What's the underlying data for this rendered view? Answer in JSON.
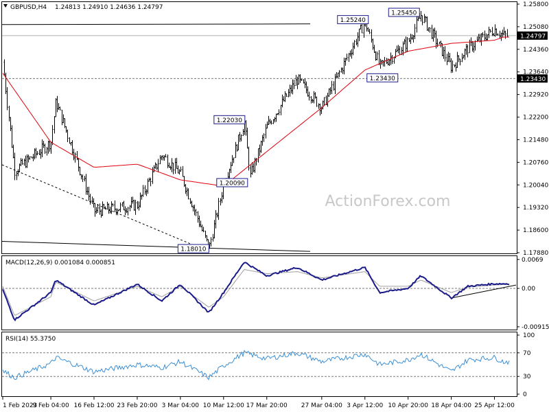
{
  "colors": {
    "background": "#ffffff",
    "candle": "#000000",
    "ma": "#e0000b",
    "macd_main": "#1a1a8a",
    "macd_signal": "#a0a0a0",
    "rsi": "#3a8fd6",
    "label_box": "#1a1a8a",
    "watermark": "#c8c8c8",
    "grid_dash": "#7a7a7a",
    "price_tag_bg": "#000000",
    "price_tag_fg": "#ffffff"
  },
  "header": {
    "symbol": "GBPUSD,H4",
    "ohlc": "1.24813 1.24910 1.24636 1.24797"
  },
  "watermark": "ActionForex.com",
  "chart_data": [
    {
      "type": "candlestick",
      "title": "GBPUSD,H4",
      "yaxis_ticks": [
        "1.25800",
        "1.25080",
        "1.24360",
        "1.23640",
        "1.22920",
        "1.22200",
        "1.21480",
        "1.20760",
        "1.20040",
        "1.19320",
        "1.18600",
        "1.17880"
      ],
      "ylim": [
        1.1788,
        1.258
      ],
      "current_price": "1.24797",
      "support_level": "1.23430",
      "annotations": [
        "1.25240",
        "1.25450",
        "1.23430",
        "1.22030",
        "1.20090",
        "1.18010"
      ],
      "x_tick_labels": [
        "1 Feb 2023",
        "9 Feb 04:00",
        "16 Feb 12:00",
        "23 Feb 20:00",
        "3 Mar 04:00",
        "10 Mar 12:00",
        "17 Mar 20:00",
        "27 Mar 04:00",
        "3 Apr 12:00",
        "10 Apr 20:00",
        "18 Apr 04:00",
        "25 Apr 12:00"
      ],
      "key_points": [
        {
          "x": "1 Feb 2023",
          "y": 1.2395
        },
        {
          "x": "3 Feb 2023",
          "y": 1.205
        },
        {
          "x": "9 Feb 04:00",
          "y": 1.214
        },
        {
          "x": "10 Feb 2023",
          "y": 1.227
        },
        {
          "x": "16 Feb 12:00",
          "y": 1.192
        },
        {
          "x": "23 Feb 20:00",
          "y": 1.194
        },
        {
          "x": "28 Feb 2023",
          "y": 1.21
        },
        {
          "x": "3 Mar 04:00",
          "y": 1.204
        },
        {
          "x": "8 Mar 2023",
          "y": 1.1801
        },
        {
          "x": "10 Mar 12:00",
          "y": 1.2009
        },
        {
          "x": "14 Mar 2023",
          "y": 1.2203
        },
        {
          "x": "15 Mar 2023",
          "y": 1.203
        },
        {
          "x": "17 Mar 20:00",
          "y": 1.219
        },
        {
          "x": "23 Mar 2023",
          "y": 1.234
        },
        {
          "x": "27 Mar 04:00",
          "y": 1.225
        },
        {
          "x": "3 Apr 12:00",
          "y": 1.2524
        },
        {
          "x": "6 Apr 2023",
          "y": 1.238
        },
        {
          "x": "10 Apr 20:00",
          "y": 1.246
        },
        {
          "x": "13 Apr 2023",
          "y": 1.2545
        },
        {
          "x": "18 Apr 04:00",
          "y": 1.238
        },
        {
          "x": "21 Apr 2023",
          "y": 1.244
        },
        {
          "x": "25 Apr 12:00",
          "y": 1.25
        },
        {
          "x": "27 Apr 2023",
          "y": 1.248
        }
      ],
      "moving_average": [
        {
          "x": "1 Feb 2023",
          "y": 1.236
        },
        {
          "x": "9 Feb 04:00",
          "y": 1.214
        },
        {
          "x": "16 Feb 12:00",
          "y": 1.206
        },
        {
          "x": "23 Feb 20:00",
          "y": 1.207
        },
        {
          "x": "3 Mar 04:00",
          "y": 1.202
        },
        {
          "x": "10 Mar 12:00",
          "y": 1.2
        },
        {
          "x": "17 Mar 20:00",
          "y": 1.211
        },
        {
          "x": "27 Mar 04:00",
          "y": 1.225
        },
        {
          "x": "3 Apr 12:00",
          "y": 1.237
        },
        {
          "x": "10 Apr 20:00",
          "y": 1.243
        },
        {
          "x": "18 Apr 04:00",
          "y": 1.2455
        },
        {
          "x": "25 Apr 12:00",
          "y": 1.2465
        },
        {
          "x": "27 Apr 2023",
          "y": 1.2475
        }
      ]
    },
    {
      "type": "line",
      "title": "MACD(12,26,9) 0.001084 0.000851",
      "yaxis_ticks": [
        "0.0069",
        "0.00",
        "-0.009158"
      ],
      "ylim": [
        -0.0095,
        0.0072
      ],
      "series": [
        {
          "name": "MACD",
          "points": [
            {
              "x": "1 Feb 2023",
              "y": -0.0003
            },
            {
              "x": "3 Feb 2023",
              "y": -0.0075
            },
            {
              "x": "9 Feb 04:00",
              "y": -0.001
            },
            {
              "x": "10 Feb 2023",
              "y": 0.002
            },
            {
              "x": "16 Feb 12:00",
              "y": -0.004
            },
            {
              "x": "23 Feb 20:00",
              "y": 0.001
            },
            {
              "x": "28 Feb 2023",
              "y": -0.003
            },
            {
              "x": "3 Mar 04:00",
              "y": 0.001
            },
            {
              "x": "8 Mar 2023",
              "y": -0.0058
            },
            {
              "x": "10 Mar 12:00",
              "y": -0.001
            },
            {
              "x": "14 Mar 2023",
              "y": 0.0063
            },
            {
              "x": "17 Mar 20:00",
              "y": 0.003
            },
            {
              "x": "23 Mar 2023",
              "y": 0.005
            },
            {
              "x": "27 Mar 04:00",
              "y": 0.002
            },
            {
              "x": "3 Apr 12:00",
              "y": 0.005
            },
            {
              "x": "6 Apr 2023",
              "y": -0.001
            },
            {
              "x": "10 Apr 20:00",
              "y": 0.0
            },
            {
              "x": "13 Apr 2023",
              "y": 0.003
            },
            {
              "x": "18 Apr 04:00",
              "y": -0.0023
            },
            {
              "x": "21 Apr 2023",
              "y": 0.0005
            },
            {
              "x": "25 Apr 12:00",
              "y": 0.0011
            },
            {
              "x": "27 Apr 2023",
              "y": 0.0011
            }
          ]
        },
        {
          "name": "Signal",
          "points": [
            {
              "x": "1 Feb 2023",
              "y": 0.0005
            },
            {
              "x": "3 Feb 2023",
              "y": -0.0065
            },
            {
              "x": "9 Feb 04:00",
              "y": -0.002
            },
            {
              "x": "10 Feb 2023",
              "y": 0.0015
            },
            {
              "x": "16 Feb 12:00",
              "y": -0.003
            },
            {
              "x": "23 Feb 20:00",
              "y": 0.0005
            },
            {
              "x": "28 Feb 2023",
              "y": -0.002
            },
            {
              "x": "3 Mar 04:00",
              "y": 0.0005
            },
            {
              "x": "8 Mar 2023",
              "y": -0.0045
            },
            {
              "x": "10 Mar 12:00",
              "y": -0.002
            },
            {
              "x": "14 Mar 2023",
              "y": 0.0045
            },
            {
              "x": "17 Mar 20:00",
              "y": 0.0035
            },
            {
              "x": "23 Mar 2023",
              "y": 0.004
            },
            {
              "x": "27 Mar 04:00",
              "y": 0.0025
            },
            {
              "x": "3 Apr 12:00",
              "y": 0.004
            },
            {
              "x": "6 Apr 2023",
              "y": 0.0005
            },
            {
              "x": "10 Apr 20:00",
              "y": 0.0005
            },
            {
              "x": "13 Apr 2023",
              "y": 0.002
            },
            {
              "x": "18 Apr 04:00",
              "y": -0.001
            },
            {
              "x": "21 Apr 2023",
              "y": 0.0003
            },
            {
              "x": "25 Apr 12:00",
              "y": 0.0008
            },
            {
              "x": "27 Apr 2023",
              "y": 0.0009
            }
          ]
        }
      ]
    },
    {
      "type": "line",
      "title": "RSI(14) 55.3750",
      "yaxis_ticks": [
        "100",
        "70",
        "30",
        "0"
      ],
      "ylim": [
        0,
        100
      ],
      "series": [
        {
          "name": "RSI",
          "points": [
            {
              "x": "1 Feb 2023",
              "y": 40
            },
            {
              "x": "3 Feb 2023",
              "y": 28
            },
            {
              "x": "9 Feb 04:00",
              "y": 52
            },
            {
              "x": "10 Feb 2023",
              "y": 62
            },
            {
              "x": "16 Feb 12:00",
              "y": 38
            },
            {
              "x": "23 Feb 20:00",
              "y": 50
            },
            {
              "x": "28 Feb 2023",
              "y": 45
            },
            {
              "x": "3 Mar 04:00",
              "y": 55
            },
            {
              "x": "8 Mar 2023",
              "y": 28
            },
            {
              "x": "10 Mar 12:00",
              "y": 48
            },
            {
              "x": "14 Mar 2023",
              "y": 70
            },
            {
              "x": "17 Mar 20:00",
              "y": 60
            },
            {
              "x": "23 Mar 2023",
              "y": 70
            },
            {
              "x": "27 Mar 04:00",
              "y": 55
            },
            {
              "x": "3 Apr 12:00",
              "y": 68
            },
            {
              "x": "6 Apr 2023",
              "y": 50
            },
            {
              "x": "10 Apr 20:00",
              "y": 58
            },
            {
              "x": "13 Apr 2023",
              "y": 68
            },
            {
              "x": "18 Apr 04:00",
              "y": 38
            },
            {
              "x": "21 Apr 2023",
              "y": 58
            },
            {
              "x": "25 Apr 12:00",
              "y": 62
            },
            {
              "x": "27 Apr 2023",
              "y": 55
            }
          ]
        }
      ]
    }
  ]
}
